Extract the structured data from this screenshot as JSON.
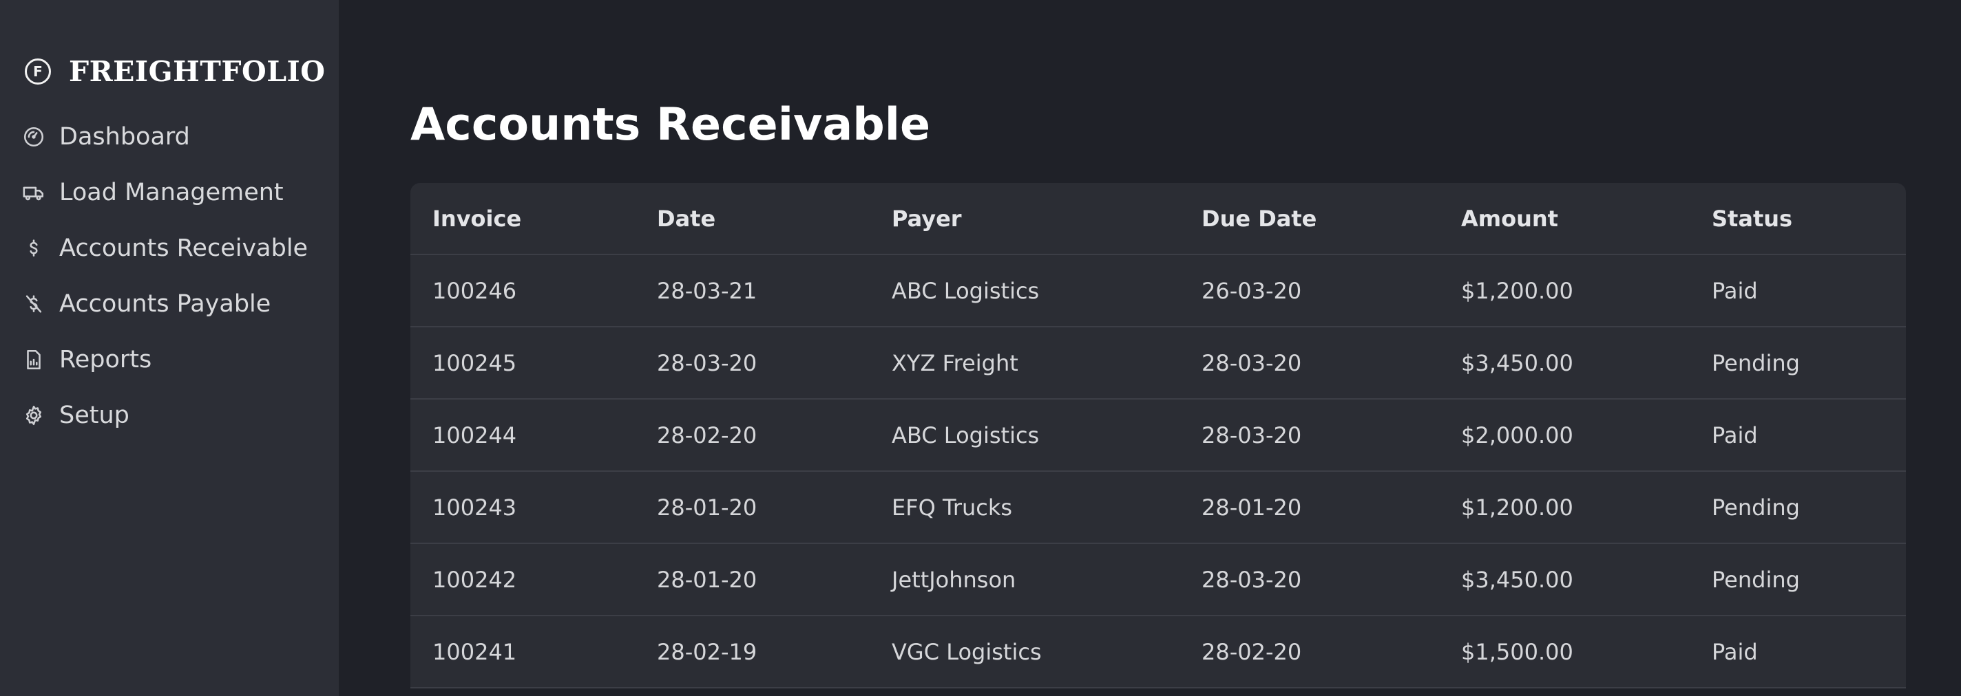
{
  "brand": {
    "icon": "F",
    "name": "FREIGHTFOLIO"
  },
  "sidebar": {
    "items": [
      {
        "label": "Dashboard",
        "icon": "gauge-icon"
      },
      {
        "label": "Load Management",
        "icon": "truck-icon"
      },
      {
        "label": "Accounts Receivable",
        "icon": "dollar-icon"
      },
      {
        "label": "Accounts Payable",
        "icon": "dollar-off-icon"
      },
      {
        "label": "Reports",
        "icon": "report-icon"
      },
      {
        "label": "Setup",
        "icon": "gear-icon"
      }
    ]
  },
  "main": {
    "title": "Accounts Receivable",
    "table": {
      "headers": [
        "Invoice",
        "Date",
        "Payer",
        "Due Date",
        "Amount",
        "Status"
      ],
      "rows": [
        [
          "100246",
          "28-03-21",
          "ABC Logistics",
          "26-03-20",
          "$1,200.00",
          "Paid"
        ],
        [
          "100245",
          "28-03-20",
          "XYZ Freight",
          "28-03-20",
          "$3,450.00",
          "Pending"
        ],
        [
          "100244",
          "28-02-20",
          "ABC Logistics",
          "28-03-20",
          "$2,000.00",
          "Paid"
        ],
        [
          "100243",
          "28-01-20",
          "EFQ Trucks",
          "28-01-20",
          "$1,200.00",
          "Pending"
        ],
        [
          "100242",
          "28-01-20",
          "JettJohnson",
          "28-03-20",
          "$3,450.00",
          "Pending"
        ],
        [
          "100241",
          "28-02-19",
          "VGC Logistics",
          "28-02-20",
          "$1,500.00",
          "Paid"
        ]
      ]
    }
  },
  "colors": {
    "background": "#1f2128",
    "sidebar": "#2c2e36",
    "table": "#2b2d34",
    "divider": "#3c3e46"
  }
}
